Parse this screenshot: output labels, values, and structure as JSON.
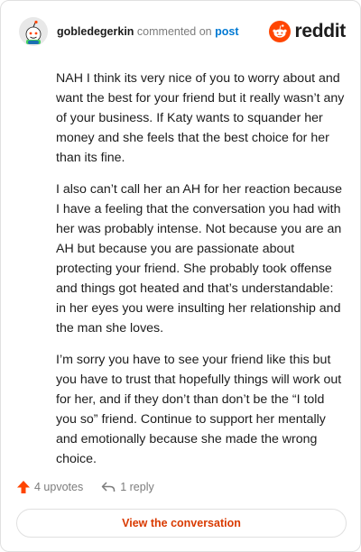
{
  "header": {
    "username": "gobledegerkin",
    "action_text": "commented on",
    "post_link": "post",
    "logo_text": "reddit",
    "avatar_icon": "snoo-avatar-icon",
    "logo_icon": "reddit-alien-logo-icon"
  },
  "comment": {
    "paragraphs": [
      "NAH I think its very nice of you to worry about and want the best for your friend but it really wasn’t any of your business. If Katy wants to squander her money and she feels that the best choice for her than its fine.",
      "I also can’t call her an AH for her reaction because I have a feeling that the conversation you had with her was probably intense. Not because you are an AH but because you are passionate about protecting your friend. She probably took offense and things got heated and that’s understandable: in her eyes you were insulting her relationship and the man she loves.",
      "I’m sorry you have to see your friend like this but you have to trust that hopefully things will work out for her, and if they don’t than don’t be the “I told you so” friend. Continue to support her mentally and emotionally because she made the wrong choice."
    ]
  },
  "footer": {
    "upvotes_label": "4 upvotes",
    "reply_label": "1 reply",
    "upvote_icon": "upvote-arrow-icon",
    "reply_icon": "reply-arrow-icon"
  },
  "view_button": {
    "label": "View the conversation"
  },
  "colors": {
    "accent": "#ff4500",
    "link": "#0079d3",
    "button_text": "#d93a00",
    "muted": "#7c7c7c"
  }
}
